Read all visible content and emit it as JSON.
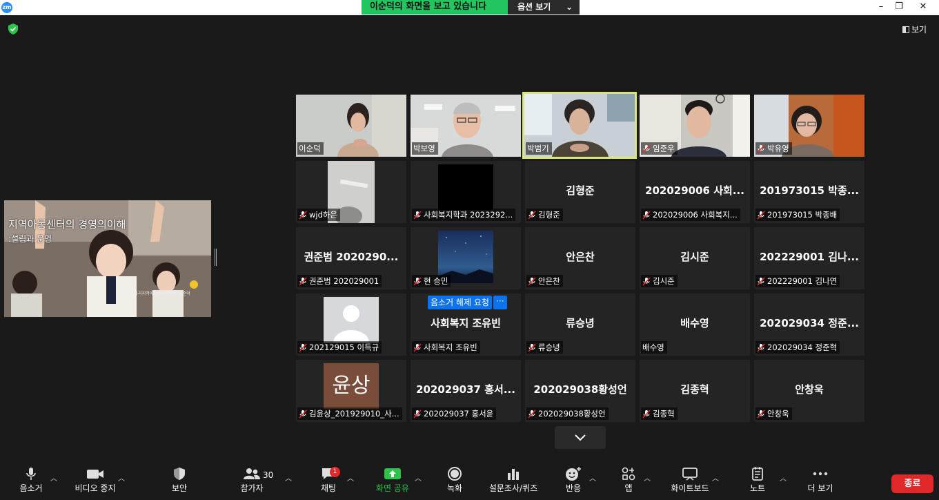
{
  "titlebar": {
    "logo": "zm",
    "banner_text": "이순덕의 화면을 보고 있습니다",
    "banner_option": "옵션 보기",
    "banner_chevron": "⌄",
    "minimize": "–",
    "restore": "❐",
    "close": "✕"
  },
  "topbar": {
    "view_label": "보기"
  },
  "share": {
    "title": "지역아동센터의 경영의이해",
    "subtitle": ":설립과 운영",
    "footnote": "행복울타리지역아동센터 센터장 이순덕"
  },
  "gallery": {
    "row1": [
      {
        "label": "이순덕",
        "muted": false
      },
      {
        "label": "박보영",
        "muted": false
      },
      {
        "label": "박범기",
        "muted": false
      },
      {
        "label": "임준우",
        "muted": true
      },
      {
        "label": "박유영",
        "muted": true
      }
    ],
    "row2": [
      {
        "center": "",
        "label": "wjd하은",
        "muted": true
      },
      {
        "center": "",
        "label": "사회복지학과 2023292...",
        "muted": true
      },
      {
        "center": "김형준",
        "label": "김형준",
        "muted": true
      },
      {
        "center": "202029006 사회...",
        "label": "202029006 사회복지...",
        "muted": true
      },
      {
        "center": "201973015 박종...",
        "label": "201973015 박종배",
        "muted": true
      }
    ],
    "row3": [
      {
        "center": "권준범 2020290...",
        "label": "권준범 202029001",
        "muted": true
      },
      {
        "center": "",
        "label": "현 승민",
        "muted": true
      },
      {
        "center": "안은찬",
        "label": "안은찬",
        "muted": true
      },
      {
        "center": "김시준",
        "label": "김시준",
        "muted": true
      },
      {
        "center": "202229001 김나...",
        "label": "202229001 김나연",
        "muted": true
      }
    ],
    "row4": [
      {
        "center": "",
        "label": "202129015 이득규",
        "muted": true
      },
      {
        "center": "사회복지 조유빈",
        "label": "사회복지 조유빈",
        "muted": true,
        "request": "음소거 해제 요청",
        "more": "···"
      },
      {
        "center": "류승녕",
        "label": "류승녕",
        "muted": true
      },
      {
        "center": "배수영",
        "label": "배수영",
        "muted": false
      },
      {
        "center": "202029034 정준...",
        "label": "202029034 정준혁",
        "muted": true
      }
    ],
    "row5": [
      {
        "center": "",
        "avatar": "윤상",
        "label": "김윤상_201929010_사...",
        "muted": true
      },
      {
        "center": "202029037 홍서...",
        "label": "202029037 홍서윤",
        "muted": true
      },
      {
        "center": "202029038황성언",
        "label": "202029038황성언",
        "muted": true
      },
      {
        "center": "김종혁",
        "label": "김종혁",
        "muted": true
      },
      {
        "center": "안창욱",
        "label": "안창욱",
        "muted": true
      }
    ]
  },
  "toolbar": {
    "mute": "음소거",
    "video_stop": "비디오 중지",
    "security": "보안",
    "participants": "참가자",
    "participants_count": "30",
    "chat": "채팅",
    "chat_badge": "1",
    "share_screen": "화면 공유",
    "record": "녹화",
    "polls": "설문조사/퀴즈",
    "reactions": "반응",
    "apps": "앱",
    "whiteboard": "화이트보드",
    "notes": "노트",
    "more": "더 보기",
    "end": "종료"
  },
  "colors": {
    "accent_green": "#22c55e",
    "end_red": "#e02828",
    "active_border": "#d9e67a",
    "unmute_blue": "#0e72ed"
  }
}
